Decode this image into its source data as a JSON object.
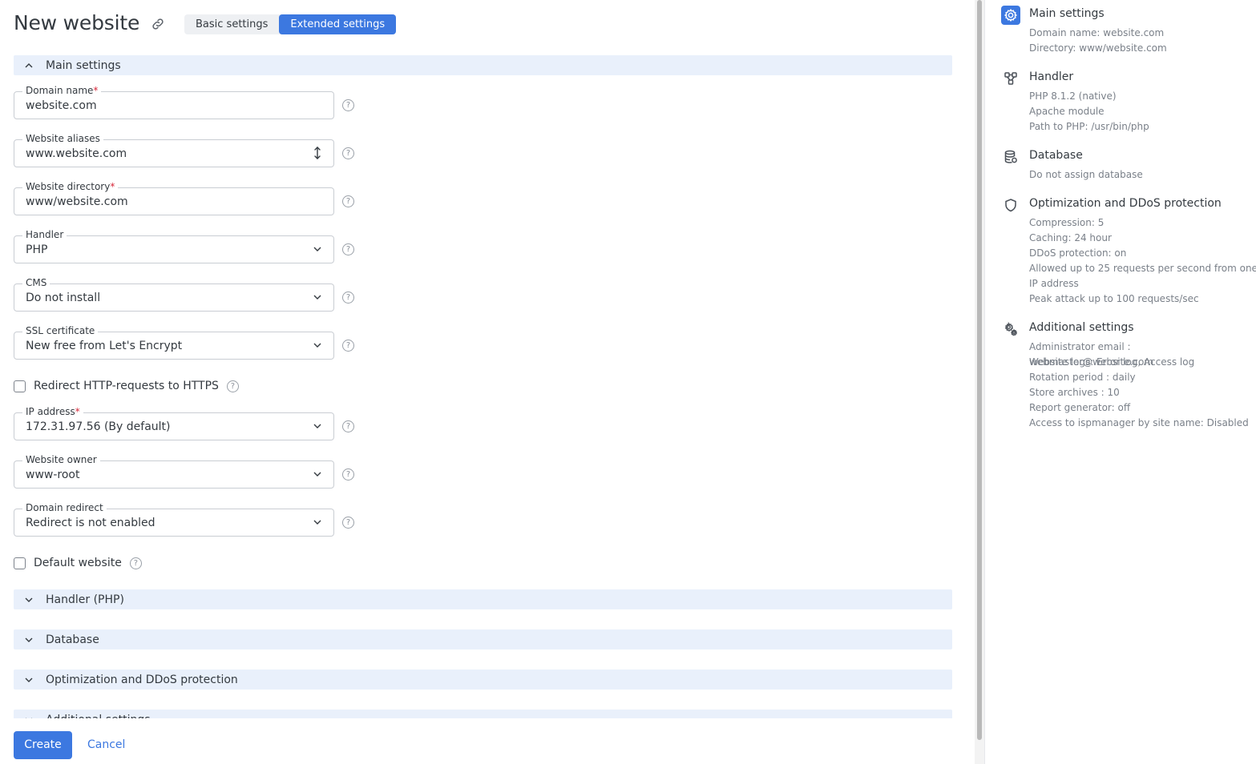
{
  "header": {
    "title": "New website",
    "tabs": [
      {
        "label": "Basic settings",
        "active": false
      },
      {
        "label": "Extended settings",
        "active": true
      }
    ]
  },
  "sections": {
    "main": "Main settings",
    "handler": "Handler (PHP)",
    "database": "Database",
    "optimization": "Optimization and DDoS protection",
    "additional": "Additional settings"
  },
  "form": {
    "domain_name": {
      "label": "Domain name",
      "required": "*",
      "value": "website.com"
    },
    "website_aliases": {
      "label": "Website aliases",
      "value": "www.website.com"
    },
    "website_directory": {
      "label": "Website directory",
      "required": "*",
      "value": "www/website.com"
    },
    "handler": {
      "label": "Handler",
      "value": "PHP"
    },
    "cms": {
      "label": "CMS",
      "value": "Do not install"
    },
    "ssl": {
      "label": "SSL certificate",
      "value": "New free from Let's Encrypt"
    },
    "redirect_https": {
      "label": "Redirect HTTP-requests to HTTPS",
      "checked": false
    },
    "ip_address": {
      "label": "IP address",
      "required": "*",
      "value": "172.31.97.56 (By default)"
    },
    "owner": {
      "label": "Website owner",
      "value": "www-root"
    },
    "domain_redirect": {
      "label": "Domain redirect",
      "value": "Redirect is not enabled"
    },
    "default_website": {
      "label": "Default website",
      "checked": false
    },
    "help_glyph": "?"
  },
  "footer": {
    "create_label": "Create",
    "cancel_label": "Cancel"
  },
  "summary": {
    "main": {
      "title": "Main settings",
      "icon": "gear-icon",
      "lines": [
        "Domain name: website.com",
        "Directory: www/website.com"
      ]
    },
    "handler": {
      "title": "Handler",
      "icon": "handler-icon",
      "lines": [
        "PHP 8.1.2 (native)",
        "Apache module",
        "Path to PHP: /usr/bin/php"
      ]
    },
    "database": {
      "title": "Database",
      "icon": "database-icon",
      "lines": [
        "Do not assign database"
      ]
    },
    "optimization": {
      "title": "Optimization and DDoS protection",
      "icon": "shield-icon",
      "lines": [
        "Compression: 5",
        "Caching: 24 hour",
        "DDoS protection: on",
        "Allowed up to 25 requests per second from one IP address",
        "Peak attack up to 100 requests/sec"
      ]
    },
    "additional": {
      "title": "Additional settings",
      "icon": "gears-icon",
      "lines": [
        "Administrator email : webmaster@website.com",
        "Website logs: Error log, Access log",
        "Rotation period : daily",
        "Store archives : 10",
        "Report generator: off",
        "Access to ispmanager by site name: Disabled"
      ]
    }
  },
  "colors": {
    "accent": "#3c78e0",
    "section_bg": "#e9f0fb",
    "required": "#d6283a"
  }
}
